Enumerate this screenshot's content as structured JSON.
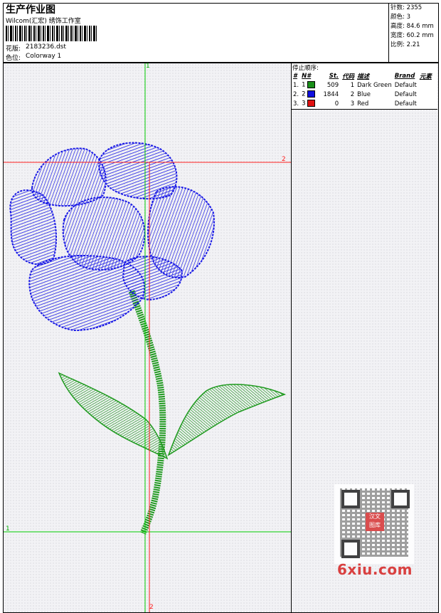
{
  "header": {
    "title": "生产作业图",
    "company": "Wilcom(汇宏) 绣饰工作室",
    "design_label": "花版:",
    "design_value": "2183236.dst",
    "colorway_label": "色位:",
    "colorway_value": "Colorway 1"
  },
  "stats": [
    {
      "label": "针数:",
      "value": "2355"
    },
    {
      "label": "颜色:",
      "value": "3"
    },
    {
      "label": "高度:",
      "value": "84.6 mm"
    },
    {
      "label": "宽度:",
      "value": "60.2 mm"
    },
    {
      "label": "比例:",
      "value": "2.21"
    }
  ],
  "stop_sequence": {
    "title": "停止顺序:",
    "columns": [
      "#",
      "N#",
      "St.",
      "代码",
      "描述",
      "Brand",
      "元素"
    ],
    "rows": [
      {
        "num": "1.",
        "n": "1",
        "swatch": "#1a8f1a",
        "st": "509",
        "code": "1",
        "desc": "Dark Green",
        "brand": "Default"
      },
      {
        "num": "2.",
        "n": "2",
        "swatch": "#1010e0",
        "st": "1844",
        "code": "2",
        "desc": "Blue",
        "brand": "Default"
      },
      {
        "num": "3.",
        "n": "3",
        "swatch": "#e01010",
        "st": "0",
        "code": "3",
        "desc": "Red",
        "brand": "Default"
      }
    ]
  },
  "markers": {
    "h1": "1",
    "h2": "2",
    "v1": "1",
    "v2": "2"
  },
  "watermark": {
    "site": "6xiu.com",
    "stamp": "汉文 图库"
  },
  "colors": {
    "blue_thread": "#1a1ae6",
    "green_thread": "#1f9a1f",
    "guide_green": "#00cc00",
    "guide_red": "#ff2020",
    "watermark_red": "#d94040"
  }
}
